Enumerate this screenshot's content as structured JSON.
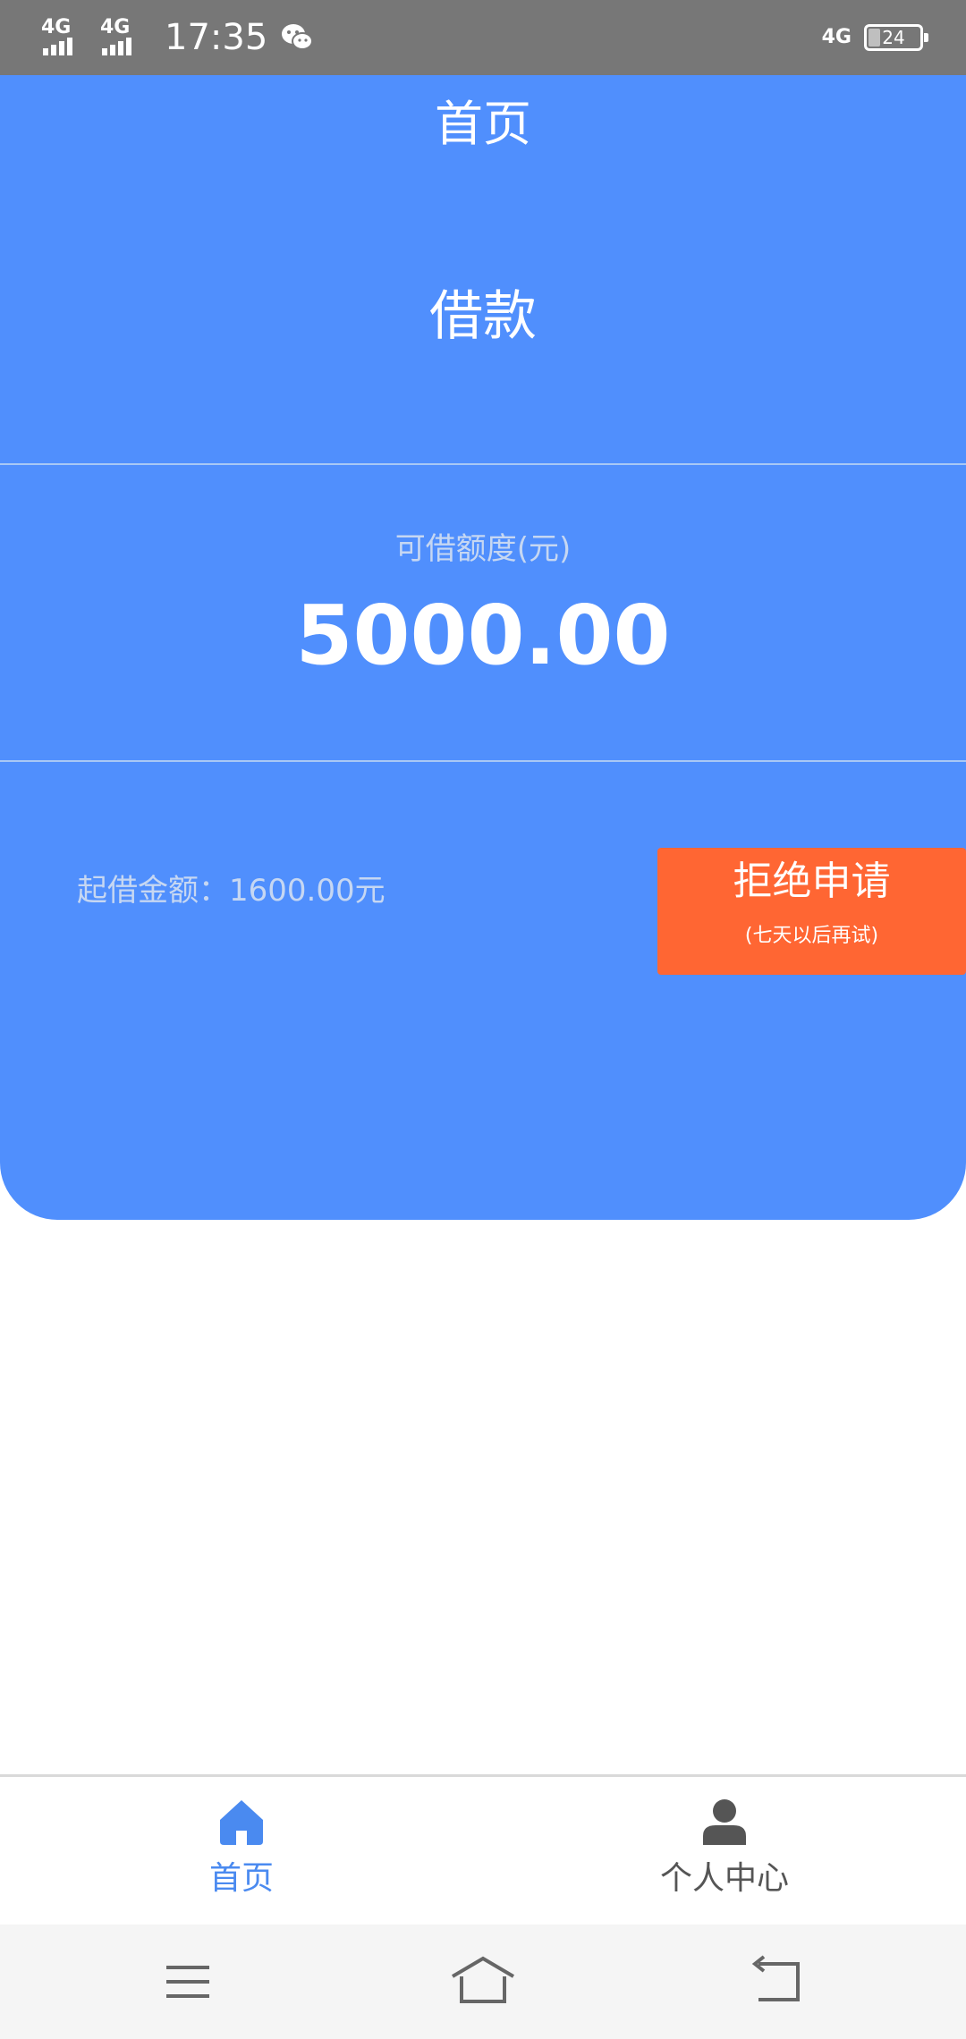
{
  "status_bar": {
    "network_1": "4G",
    "network_2": "4G",
    "time": "17:35",
    "network_right": "4G",
    "battery_level": "24",
    "battery_fraction": 0.24,
    "icons": [
      "signal-icon",
      "signal-icon",
      "wechat-icon",
      "battery-icon"
    ]
  },
  "header": {
    "title": "首页"
  },
  "loan": {
    "section_title": "借款",
    "quota_label": "可借额度(元)",
    "quota_value": "5000.00",
    "min_amount_label": "起借金额：1600.00元",
    "reject_label": "拒绝申请",
    "reject_note": "(七天以后再试)"
  },
  "tabs": [
    {
      "label": "首页",
      "icon": "home-icon",
      "active": true
    },
    {
      "label": "个人中心",
      "icon": "person-icon",
      "active": false
    }
  ],
  "colors": {
    "primary_blue": "#508ffd",
    "reject_orange": "#ff6633",
    "tab_active": "#4a8af0",
    "tab_inactive": "#555555",
    "status_bar": "#777777"
  },
  "nav_icons": [
    "menu-icon",
    "home-nav-icon",
    "back-icon"
  ]
}
